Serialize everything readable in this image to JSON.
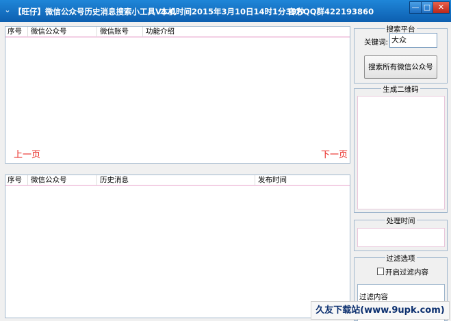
{
  "titlebar": {
    "title": "【旺仔】微信公众号历史消息搜索小工具V1.0",
    "time": "本机时间2015年3月10日14时1分39秒",
    "qq": "官方QQ群422193860",
    "app_icon": "double-chevron-down-icon",
    "minimize": "—",
    "maximize": "□",
    "close": "✕"
  },
  "top_list": {
    "columns": [
      "序号",
      "微信公众号",
      "微信账号",
      "功能介绍"
    ],
    "prev_label": "上一页",
    "next_label": "下一页"
  },
  "bottom_list": {
    "columns": [
      "序号",
      "微信公众号",
      "历史消息",
      "发布时间"
    ]
  },
  "search_group": {
    "title": "搜索平台",
    "keyword_label": "关键词:",
    "keyword_value": "大众",
    "search_button": "搜索所有微信公众号"
  },
  "qrcode_group": {
    "title": "生成二维码"
  },
  "time_group": {
    "title": "处理时间"
  },
  "filter_group": {
    "title": "过滤选项",
    "checkbox_label": "开启过滤内容",
    "content_label": "过滤内容"
  },
  "watermark": "久友下载站(www.9upk.com)"
}
